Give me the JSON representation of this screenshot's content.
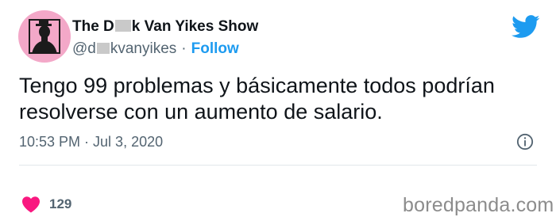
{
  "tweet": {
    "author": {
      "name_start": "The D",
      "name_end": "k Van Yikes Show",
      "handle_start": "@d",
      "handle_end": "kvanyikes",
      "separator": "·",
      "follow_label": "Follow"
    },
    "text": "Tengo 99 problemas y básicamente todos podrían resolverse con un aumento de salario.",
    "timestamp": "10:53 PM · Jul 3, 2020",
    "likes": "129"
  },
  "watermark": "boredpanda.com",
  "colors": {
    "accent": "#1d9bf0",
    "heart": "#f91880",
    "avatar_bg": "#f3a8c8",
    "secondary_text": "#536471"
  },
  "icons": [
    "twitter-bird-icon",
    "info-icon",
    "heart-icon"
  ]
}
